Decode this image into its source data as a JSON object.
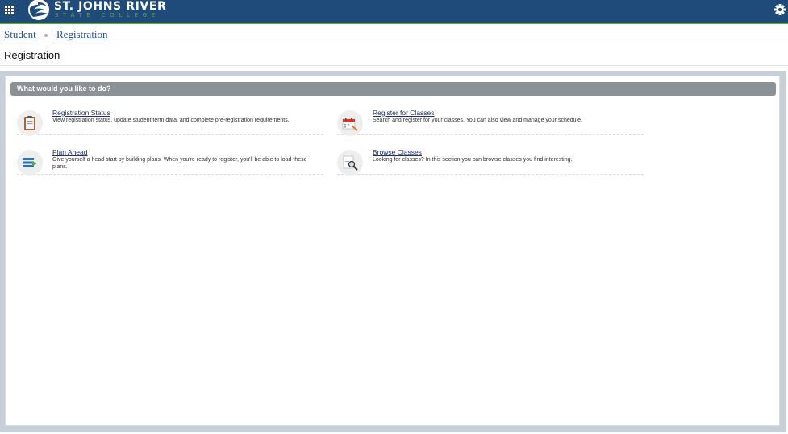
{
  "header": {
    "logo_name": "ST. JOHNS RIVER",
    "logo_sub": "STATE COLLEGE"
  },
  "breadcrumb": {
    "items": [
      {
        "label": "Student"
      },
      {
        "label": "Registration"
      }
    ]
  },
  "page": {
    "title": "Registration"
  },
  "section": {
    "header": "What would you like to do?",
    "tiles": [
      {
        "title": "Registration Status",
        "description": "View registration status, update student term data, and complete pre-registration requirements.",
        "icon": "clipboard-icon"
      },
      {
        "title": "Register for Classes",
        "description": "Search and register for your classes. You can also view and manage your schedule.",
        "icon": "calendar-icon"
      },
      {
        "title": "Plan Ahead",
        "description": "Give yourself a head start by building plans. When you're ready to register, you'll be able to load these plans.",
        "icon": "plan-list-icon"
      },
      {
        "title": "Browse Classes",
        "description": "Looking for classes? In this section you can browse classes you find interesting.",
        "icon": "magnifier-document-icon"
      }
    ]
  },
  "colors": {
    "header_bg": "#1e4b7a",
    "accent_green": "#5ea43a",
    "section_header_bg": "#8a9297",
    "link": "#2b4f9c"
  }
}
